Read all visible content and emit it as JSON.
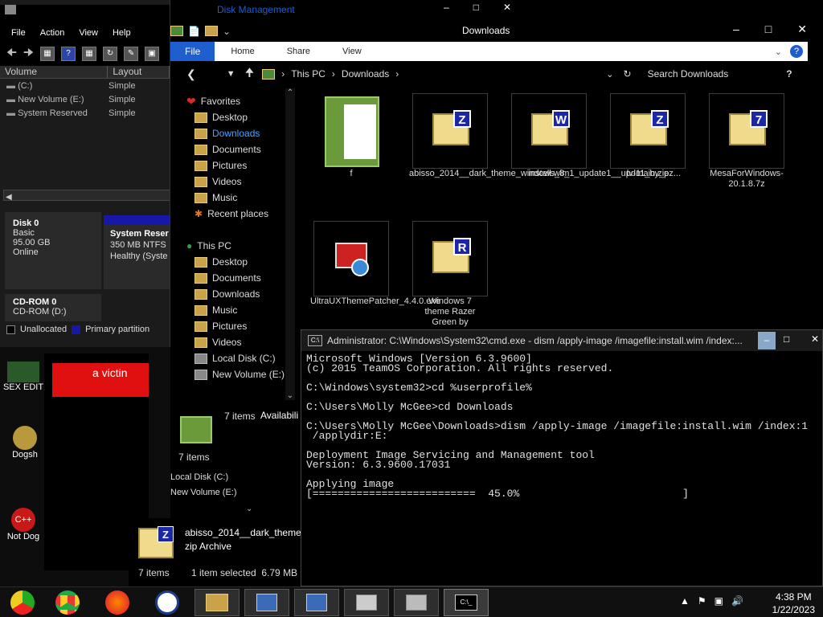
{
  "desktop": {
    "icons": [
      {
        "label": "SEX EDIT"
      },
      {
        "label": "Dogsh"
      },
      {
        "label": "Not Dog"
      }
    ],
    "banner_text": "a victin"
  },
  "disk_management": {
    "title": "Disk Management",
    "menu": [
      "File",
      "Action",
      "View",
      "Help"
    ],
    "columns": [
      "Volume",
      "Layout"
    ],
    "volumes": [
      {
        "name": "(C:)",
        "layout": "Simple"
      },
      {
        "name": "New Volume (E:)",
        "layout": "Simple"
      },
      {
        "name": "System Reserved",
        "layout": "Simple"
      }
    ],
    "disk0": {
      "name": "Disk 0",
      "type": "Basic",
      "size": "95.00 GB",
      "status": "Online"
    },
    "partition": {
      "name": "System Reser",
      "size": "350 MB NTFS",
      "status": "Healthy (Syste"
    },
    "cdrom": {
      "name": "CD-ROM 0",
      "drive": "CD-ROM (D:)"
    },
    "legend": [
      {
        "label": "Unallocated",
        "color": "#000000"
      },
      {
        "label": "Primary partition",
        "color": "#1818a8"
      }
    ]
  },
  "explorer": {
    "title": "Downloads",
    "ribbon": {
      "file": "File",
      "tabs": [
        "Home",
        "Share",
        "View"
      ]
    },
    "address": {
      "root": "This PC",
      "folder": "Downloads"
    },
    "search_placeholder": "Search Downloads",
    "help": "?",
    "favorites_label": "Favorites",
    "favorites": [
      "Desktop",
      "Downloads",
      "Documents",
      "Pictures",
      "Videos",
      "Music",
      "Recent places"
    ],
    "thispc_label": "This PC",
    "thispc": [
      "Desktop",
      "Documents",
      "Downloads",
      "Music",
      "Pictures",
      "Videos",
      "Local Disk (C:)",
      "New Volume (E:)"
    ],
    "files": [
      {
        "name": "f",
        "badge": ""
      },
      {
        "name": "abisso_2014__dark_theme_windows_8_1_update1__upd11_by_ez...",
        "badge": "Z"
      },
      {
        "name": "install.wim",
        "badge": "W"
      },
      {
        "name": "lv-main.zip",
        "badge": "Z"
      },
      {
        "name": "MesaForWindows-20.1.8.7z",
        "badge": "7"
      },
      {
        "name": "UltraUXThemePatcher_4.4.0.exe",
        "badge": ""
      },
      {
        "name": "Windows 7 theme Razer Green by",
        "badge": "R"
      }
    ],
    "status_items": "7 items",
    "status_avail": "Availabili"
  },
  "explorer2": {
    "items": "7 items",
    "nav": [
      "Local Disk (C:)",
      "New Volume (E:)"
    ],
    "selected_name": "abisso_2014__dark_theme",
    "selected_type": "zip Archive",
    "status_items": "7 items",
    "status_selected": "1 item selected  6.79 MB"
  },
  "cmd": {
    "title": "Administrator: C:\\Windows\\System32\\cmd.exe - dism  /apply-image /imagefile:install.wim /index:...",
    "lines": [
      "Microsoft Windows [Version 6.3.9600]",
      "(c) 2015 TeamOS Corporation. All rights reserved.",
      "",
      "C:\\Windows\\system32>cd %userprofile%",
      "",
      "C:\\Users\\Molly McGee>cd Downloads",
      "",
      "C:\\Users\\Molly McGee\\Downloads>dism /apply-image /imagefile:install.wim /index:1",
      " /applydir:E:",
      "",
      "Deployment Image Servicing and Management tool",
      "Version: 6.3.9600.17031",
      "",
      "Applying image",
      "[==========================  45.0%                          ]"
    ],
    "progress_percent": 45.0
  },
  "taskbar": {
    "time": "4:38 PM",
    "date": "1/22/2023"
  },
  "colors": {
    "accent": "#1e5ecf",
    "selected_nav": "#4aa3ff",
    "red_banner": "#e01010"
  }
}
